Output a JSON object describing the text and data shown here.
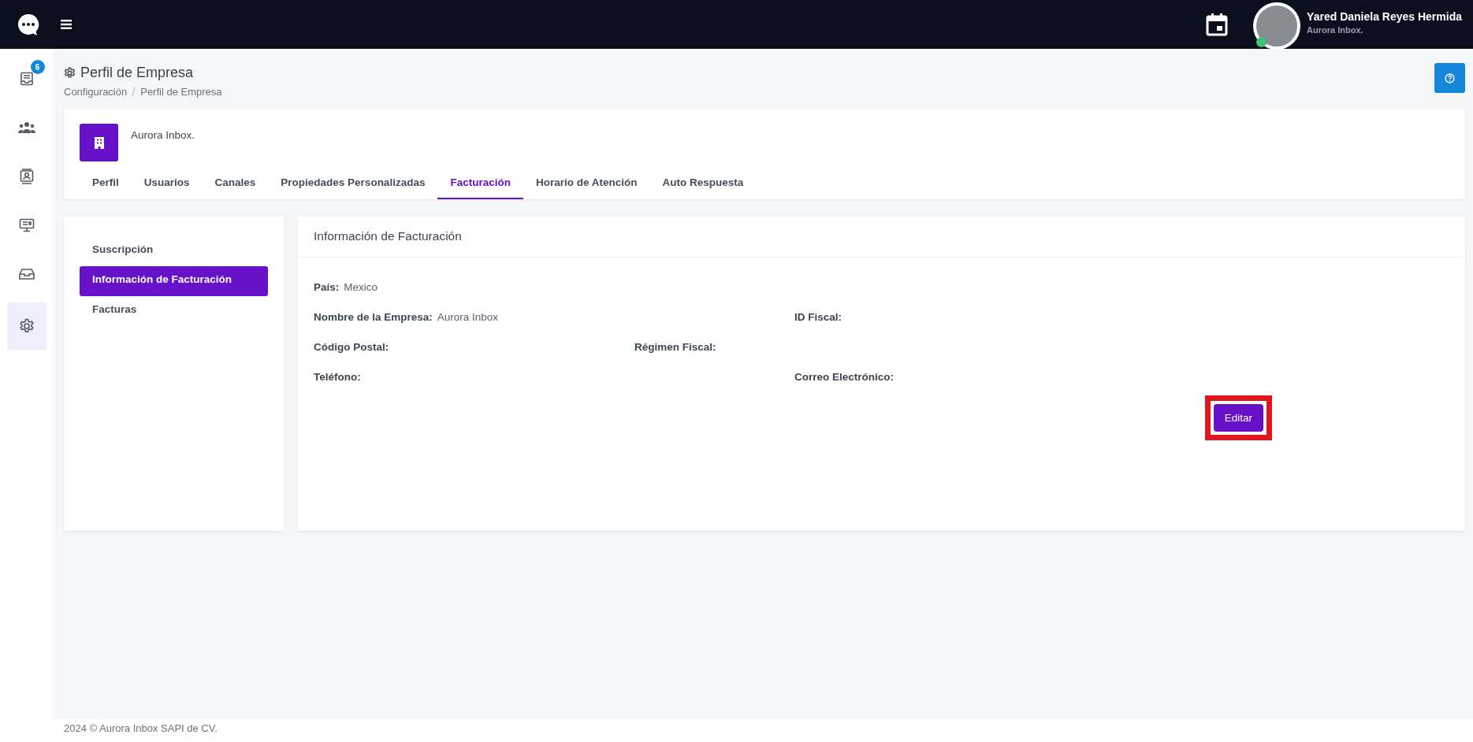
{
  "topbar": {
    "user": {
      "name": "Yared Daniela Reyes Hermida",
      "company": "Aurora Inbox.",
      "online": true
    }
  },
  "sidebar": {
    "items": [
      {
        "kind": "inbox",
        "badge": "6",
        "selected": false
      },
      {
        "kind": "team",
        "selected": false
      },
      {
        "kind": "contact",
        "selected": false
      },
      {
        "kind": "monitor",
        "selected": false
      },
      {
        "kind": "tray",
        "selected": false
      },
      {
        "kind": "settings",
        "selected": true
      }
    ]
  },
  "page": {
    "title": "Perfil de Empresa",
    "breadcrumb": [
      "Configuración",
      "Perfil de Empresa"
    ]
  },
  "company": {
    "name": "Aurora Inbox.",
    "tabs": [
      {
        "label": "Perfil",
        "selected": false
      },
      {
        "label": "Usuarios",
        "selected": false
      },
      {
        "label": "Canales",
        "selected": false
      },
      {
        "label": "Propiedades Personalizadas",
        "selected": false
      },
      {
        "label": "Facturación",
        "selected": true
      },
      {
        "label": "Horario de Atención",
        "selected": false
      },
      {
        "label": "Auto Respuesta",
        "selected": false
      }
    ]
  },
  "billing_menu": [
    {
      "label": "Suscripción",
      "selected": false
    },
    {
      "label": "Información de Facturación",
      "selected": true
    },
    {
      "label": "Facturas",
      "selected": false
    }
  ],
  "billing_info": {
    "title": "Información de Facturación",
    "rows": [
      [
        {
          "label": "País:",
          "value": "Mexico"
        }
      ],
      [
        {
          "label": "Nombre de la Empresa:",
          "value": "Aurora Inbox"
        },
        {
          "label": "ID Fiscal:"
        }
      ],
      [
        {
          "label": "Código Postal:"
        },
        {
          "label": "Régimen Fiscal:"
        }
      ],
      [
        {
          "label": "Teléfono:"
        },
        {
          "label": "Correo Electrónico:"
        }
      ]
    ],
    "edit_button": {
      "label": "Editar",
      "highlighted": true
    }
  },
  "footer": "2024 © Aurora Inbox SAPI de CV."
}
